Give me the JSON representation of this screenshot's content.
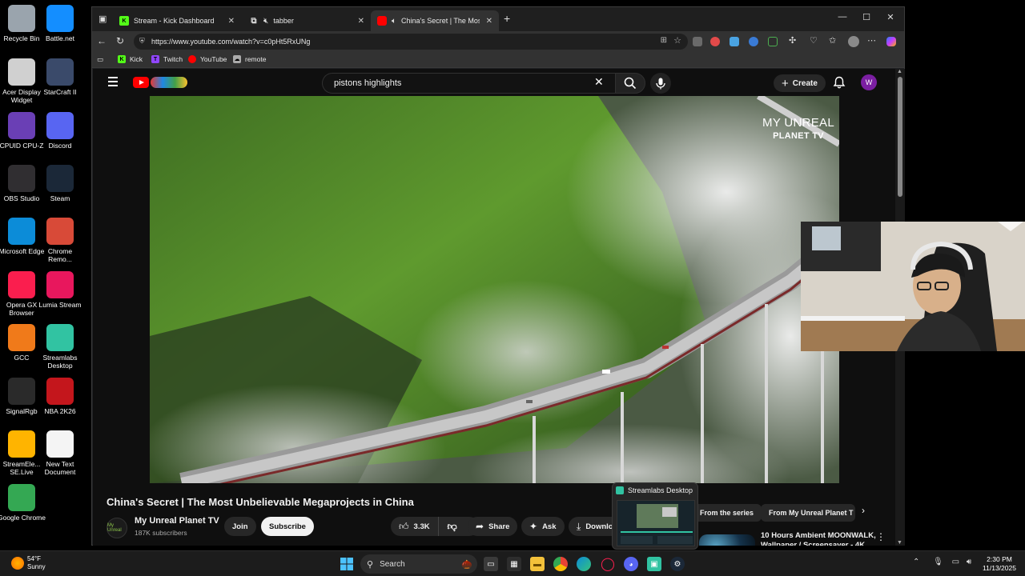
{
  "desktop": {
    "icons": [
      {
        "label": "Recycle Bin",
        "icon": "recycle-bin-icon",
        "color": "#9aa4ad"
      },
      {
        "label": "Battle.net",
        "icon": "battle-net-icon",
        "color": "#148eff"
      },
      {
        "label": "Acer Display Widget",
        "icon": "acer-display-icon",
        "color": "#d0d0d0"
      },
      {
        "label": "StarCraft II",
        "icon": "starcraft-icon",
        "color": "#3a4a6a"
      },
      {
        "label": "CPUID CPU-Z",
        "icon": "cpu-z-icon",
        "color": "#6a3fb5"
      },
      {
        "label": "Discord",
        "icon": "discord-icon",
        "color": "#5865f2"
      },
      {
        "label": "OBS Studio",
        "icon": "obs-icon",
        "color": "#302e31"
      },
      {
        "label": "Steam",
        "icon": "steam-icon",
        "color": "#1b2838"
      },
      {
        "label": "Microsoft Edge",
        "icon": "edge-icon",
        "color": "#0c8cd8"
      },
      {
        "label": "Chrome Remo...",
        "icon": "chrome-remote-icon",
        "color": "#d84a38"
      },
      {
        "label": "Opera GX Browser",
        "icon": "opera-gx-icon",
        "color": "#fa1e4e"
      },
      {
        "label": "Lumia Stream",
        "icon": "lumia-stream-icon",
        "color": "#e8175d"
      },
      {
        "label": "GCC",
        "icon": "gcc-icon",
        "color": "#f07a1a"
      },
      {
        "label": "Streamlabs Desktop",
        "icon": "streamlabs-icon",
        "color": "#31c3a2"
      },
      {
        "label": "SignalRgb",
        "icon": "signalrgb-icon",
        "color": "#2a2a2a"
      },
      {
        "label": "NBA 2K26",
        "icon": "nba-2k26-icon",
        "color": "#c4161c"
      },
      {
        "label": "StreamEle... SE.Live",
        "icon": "streamelements-icon",
        "color": "#ffb400"
      },
      {
        "label": "New Text Document",
        "icon": "text-document-icon",
        "color": "#f4f4f4"
      },
      {
        "label": "Google Chrome",
        "icon": "chrome-icon",
        "color": "#34a853"
      }
    ]
  },
  "browser": {
    "tabs": [
      {
        "label": "Stream - Kick Dashboard",
        "icon": "kick-icon",
        "color": "#53fc18"
      },
      {
        "label": "tabber",
        "icon": "tab-icon",
        "color": "#777777"
      },
      {
        "label": "China's Secret | The Most Ur",
        "icon": "youtube-icon",
        "color": "#ff0000"
      }
    ],
    "url": "https://www.youtube.com/watch?v=c0pHt5RxUNg",
    "bookmarks": [
      {
        "label": "Kick",
        "icon": "kick-icon",
        "color": "#53fc18"
      },
      {
        "label": "Twitch",
        "icon": "twitch-icon",
        "color": "#9146ff"
      },
      {
        "label": "YouTube",
        "icon": "youtube-icon",
        "color": "#ff0000"
      },
      {
        "label": "remote",
        "icon": "remote-icon",
        "color": "#aaaaaa"
      }
    ]
  },
  "youtube": {
    "search_value": "pistons highlights",
    "create_label": "Create",
    "avatar_letter": "W",
    "watermark_line1": "MY UNREAL",
    "watermark_line2": "PLANET TV",
    "video_title": "China's Secret | The Most Unbelievable Megaprojects in China",
    "channel_name": "My Unreal Planet TV",
    "channel_avatar_text": "My Unreal",
    "subscribers": "187K subscribers",
    "join_label": "Join",
    "subscribe_label": "Subscribe",
    "like_count": "3.3K",
    "share_label": "Share",
    "ask_label": "Ask",
    "download_label": "Downlo",
    "chips": [
      "From the series",
      "From My Unreal Planet T"
    ],
    "rec_title": "10 Hours Ambient MOONWALK, Wallpaper / Screensaver - 4K"
  },
  "taskbar": {
    "weather_temp": "54°F",
    "weather_desc": "Sunny",
    "search_label": "Search",
    "preview_title": "Streamlabs Desktop",
    "time": "2:30 PM",
    "date": "11/13/2025"
  },
  "colors": {
    "yt_bg": "#0f0f0f",
    "yt_red": "#ff0000",
    "accent_purple": "#7b1fa2"
  }
}
